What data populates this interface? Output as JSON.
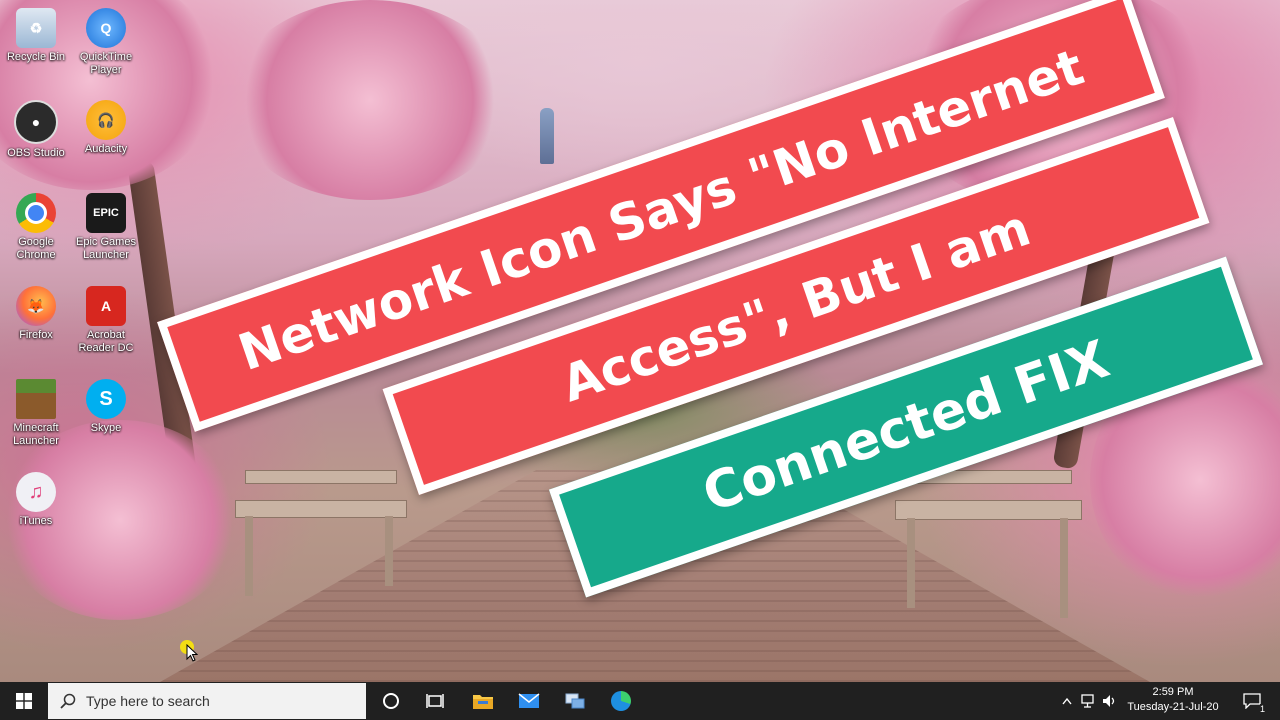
{
  "desktop": {
    "icons": [
      {
        "label": "Recycle Bin",
        "icon": "recycle-bin-icon",
        "color": "#9bb7d4"
      },
      {
        "label": "QuickTime Player",
        "icon": "quicktime-icon",
        "color": "#1e73d8"
      },
      {
        "label": "OBS Studio",
        "icon": "obs-icon",
        "color": "#2b2b2b"
      },
      {
        "label": "Audacity",
        "icon": "audacity-icon",
        "color": "#f4a40c"
      },
      {
        "label": "Google Chrome",
        "icon": "chrome-icon",
        "color": "#34a853"
      },
      {
        "label": "Epic Games Launcher",
        "icon": "epic-games-icon",
        "color": "#1a1a1a",
        "glyph": "EPIC"
      },
      {
        "label": "Firefox",
        "icon": "firefox-icon",
        "color": "#ff7139"
      },
      {
        "label": "Acrobat Reader DC",
        "icon": "acrobat-icon",
        "color": "#d7271f"
      },
      {
        "label": "Minecraft Launcher",
        "icon": "minecraft-icon",
        "color": "#5b8a32"
      },
      {
        "label": "Skype",
        "icon": "skype-icon",
        "color": "#00aff0",
        "glyph": "S"
      },
      {
        "label": "iTunes",
        "icon": "itunes-icon",
        "color": "#f0f0f5",
        "glyph": "♫"
      }
    ]
  },
  "banners": {
    "line1": "Network Icon Says \"No Internet",
    "line2": "Access\", But I am",
    "line3": "Connected FIX",
    "red_color": "#f24a4f",
    "green_color": "#16a98b"
  },
  "taskbar": {
    "search_placeholder": "Type here to search",
    "clock_time": "2:59 PM",
    "clock_date": "Tuesday-21-Jul-20",
    "notification_count": "1",
    "pinned": [
      "task-view-icon",
      "file-explorer-icon",
      "mail-icon",
      "network-tool-icon",
      "edge-icon"
    ]
  }
}
